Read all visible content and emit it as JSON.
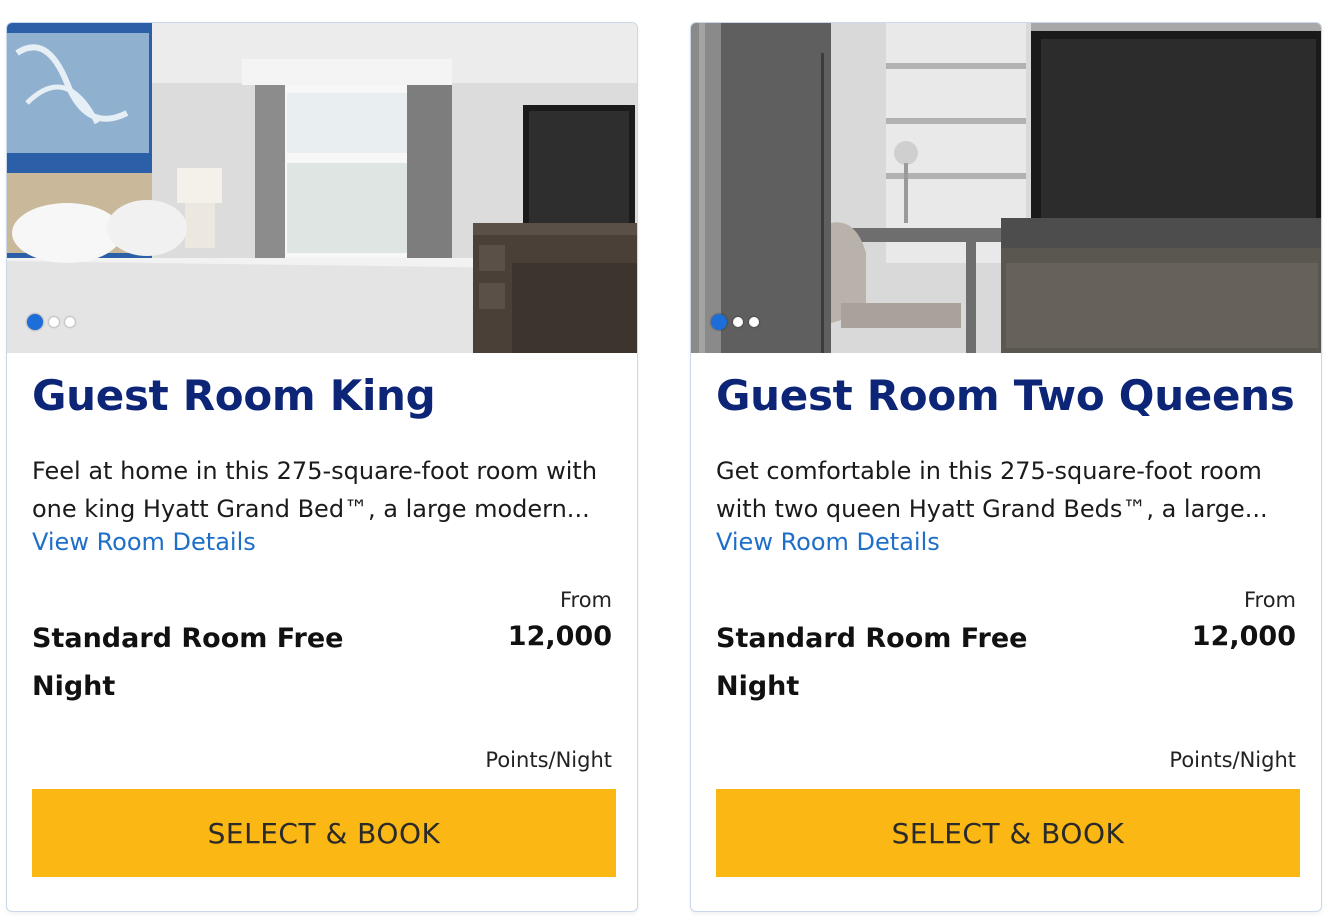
{
  "rooms": [
    {
      "name": "Guest Room King",
      "description": "Feel at home in this 275-square-foot room with one king Hyatt Grand Bed™, a large modern...",
      "details_link": "View Room Details",
      "from_label": "From",
      "rate_name": "Standard Room Free Night",
      "points": "12,000",
      "unit": "Points/Night",
      "button_label": "SELECT & BOOK",
      "carousel": {
        "total": 3,
        "active": 1
      }
    },
    {
      "name": "Guest Room Two Queens",
      "description": "Get comfortable in this 275-square-foot room with two queen Hyatt Grand Beds™, a large...",
      "details_link": "View Room Details",
      "from_label": "From",
      "rate_name": "Standard Room Free Night",
      "points": "12,000",
      "unit": "Points/Night",
      "button_label": "SELECT & BOOK",
      "carousel": {
        "total": 3,
        "active": 1
      }
    }
  ],
  "colors": {
    "title": "#0c2577",
    "link": "#1f6fc8",
    "button": "#fbb714",
    "active_dot": "#1d6ed8",
    "card_border": "#c9d8ea"
  }
}
